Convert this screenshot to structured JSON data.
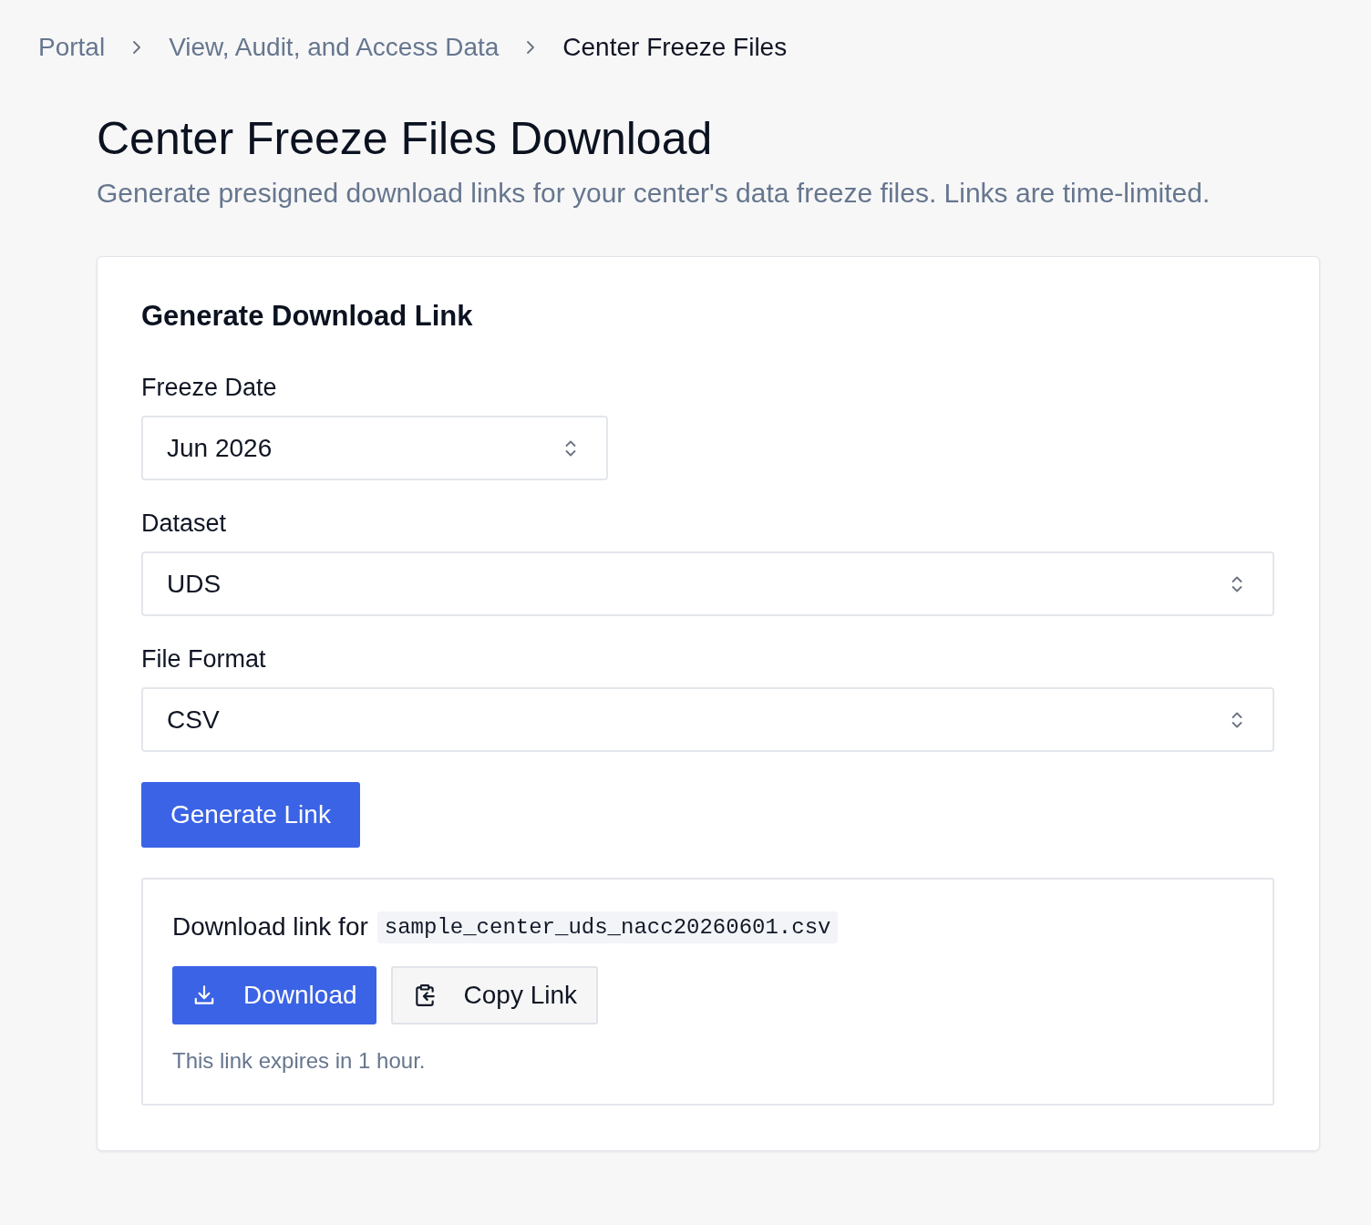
{
  "breadcrumb": [
    {
      "label": "Portal",
      "current": false
    },
    {
      "label": "View, Audit, and Access Data",
      "current": false
    },
    {
      "label": "Center Freeze Files",
      "current": true
    }
  ],
  "page": {
    "title": "Center Freeze Files Download",
    "subtitle": "Generate presigned download links for your center's data freeze files. Links are time-limited."
  },
  "card": {
    "title": "Generate Download Link",
    "fields": [
      {
        "label": "Freeze Date",
        "value": "Jun 2026",
        "kind": "short-select"
      },
      {
        "label": "Dataset",
        "value": "UDS",
        "kind": "select"
      },
      {
        "label": "File Format",
        "value": "CSV",
        "kind": "select"
      }
    ],
    "generate_button": "Generate Link",
    "result": {
      "label": "Download link for",
      "filename": "sample_center_uds_nacc20260601.csv",
      "buttons": [
        {
          "label": "Download",
          "kind": "download"
        },
        {
          "label": "Copy Link",
          "kind": "copy"
        }
      ],
      "note": "This link expires in 1 hour."
    }
  }
}
